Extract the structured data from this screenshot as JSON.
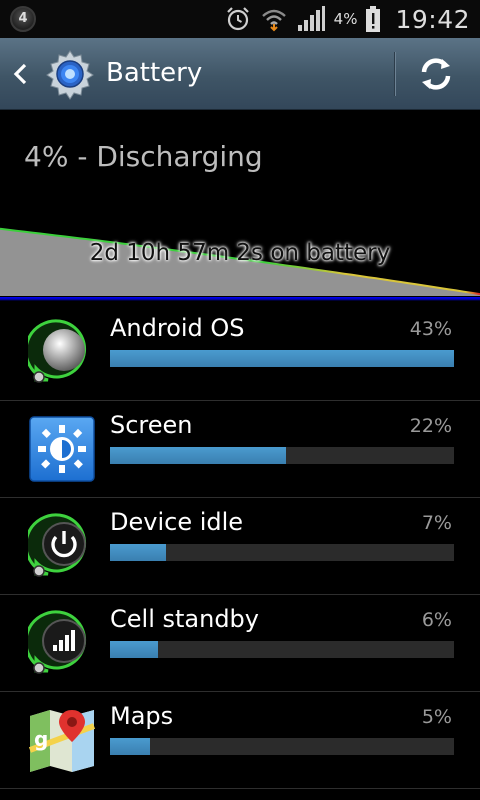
{
  "status_bar": {
    "notification_badge": "4",
    "icons": [
      "alarm-icon",
      "wifi-icon",
      "signal-icon",
      "battery-alert-icon"
    ],
    "battery_percent": "4%",
    "time": "19:42"
  },
  "action_bar": {
    "title": "Battery",
    "back_icon": "chevron-left-icon",
    "app_icon": "settings-gear-icon",
    "refresh_icon": "refresh-icon"
  },
  "battery": {
    "status_text": "4% - Discharging",
    "on_battery_text": "2d 10h 57m 2s on battery",
    "level_fraction_start": 0.73,
    "level_fraction_end": 0.02
  },
  "usage": [
    {
      "name": "Android OS",
      "percent_label": "43%",
      "percent": 43,
      "icon": "android-os-icon"
    },
    {
      "name": "Screen",
      "percent_label": "22%",
      "percent": 22,
      "icon": "screen-brightness-icon"
    },
    {
      "name": "Device idle",
      "percent_label": "7%",
      "percent": 7,
      "icon": "power-icon"
    },
    {
      "name": "Cell standby",
      "percent_label": "6%",
      "percent": 6,
      "icon": "cell-signal-icon"
    },
    {
      "name": "Maps",
      "percent_label": "5%",
      "percent": 5,
      "icon": "maps-icon"
    }
  ],
  "colors": {
    "usage_bar": "#4a9bcf",
    "usage_track": "#2b2b2b",
    "action_bar": "#4a6174",
    "graph_line_high": "#3bcf3b",
    "graph_line_low": "#d9c53a",
    "graph_baseline": "#0000ff"
  }
}
